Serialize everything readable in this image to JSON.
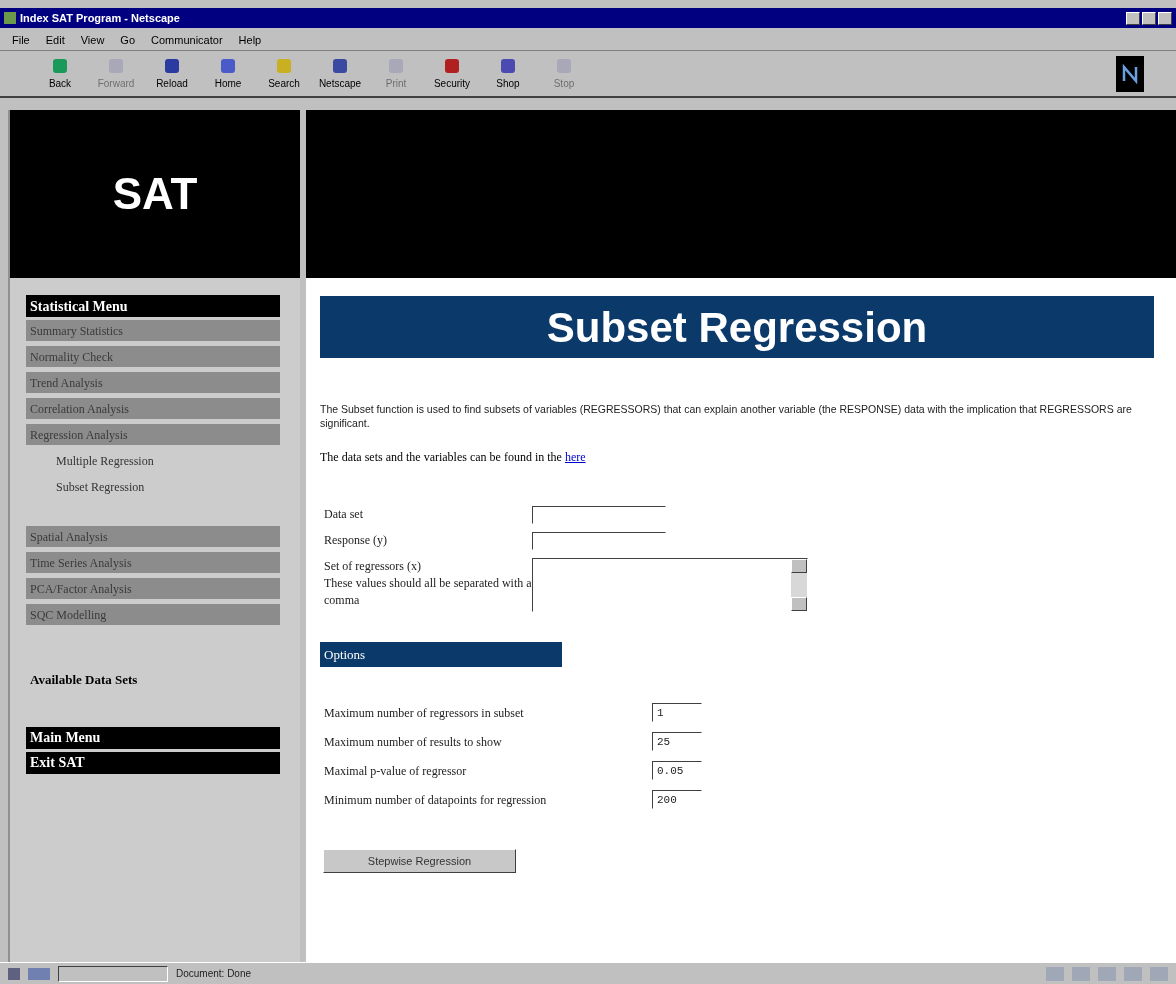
{
  "window": {
    "title": "Index SAT Program - Netscape"
  },
  "menu_bar": [
    "File",
    "Edit",
    "View",
    "Go",
    "Communicator",
    "Help"
  ],
  "toolbar": [
    {
      "label": "Back",
      "disabled": false
    },
    {
      "label": "Forward",
      "disabled": true
    },
    {
      "label": "Reload",
      "disabled": false
    },
    {
      "label": "Home",
      "disabled": false
    },
    {
      "label": "Search",
      "disabled": false
    },
    {
      "label": "Netscape",
      "disabled": false
    },
    {
      "label": "Print",
      "disabled": true
    },
    {
      "label": "Security",
      "disabled": false
    },
    {
      "label": "Shop",
      "disabled": false
    },
    {
      "label": "Stop",
      "disabled": true
    }
  ],
  "banner": {
    "logo": "SAT"
  },
  "sidebar": {
    "heading": "Statistical Menu",
    "items": [
      {
        "label": "Summary Statistics"
      },
      {
        "label": "Normality Check"
      },
      {
        "label": "Trend Analysis"
      },
      {
        "label": "Correlation Analysis"
      },
      {
        "label": "Regression Analysis",
        "children": [
          {
            "label": "Multiple Regression"
          },
          {
            "label": "Subset Regression"
          }
        ]
      },
      {
        "label": "Spatial Analysis"
      },
      {
        "label": "Time Series Analysis"
      },
      {
        "label": "PCA/Factor Analysis"
      },
      {
        "label": "SQC Modelling"
      }
    ],
    "data_sets": "Available Data Sets",
    "footer_items": [
      "Main Menu",
      "Exit SAT"
    ]
  },
  "content": {
    "title": "Subset Regression",
    "description": "The Subset function is used to find subsets of variables (REGRESSORS) that can explain another variable (the RESPONSE) data with the implication that REGRESSORS are significant.",
    "data_note": "The data sets and the variables can be found in the",
    "data_link": "here",
    "fields": [
      {
        "label": "Data set",
        "kind": "text"
      },
      {
        "label": "Response (y)",
        "kind": "text"
      },
      {
        "label": "Set of regressors (x)\nThese values should all be separated with a comma",
        "kind": "textarea"
      }
    ],
    "options_heading": "Options",
    "options": [
      {
        "label": "Maximum number of regressors in subset",
        "value": "1"
      },
      {
        "label": "Maximum number of results to show",
        "value": "25"
      },
      {
        "label": "Maximal p-value of regressor",
        "value": "0.05"
      },
      {
        "label": "Minimum number of datapoints for regression",
        "value": "200"
      }
    ],
    "button": "Stepwise Regression"
  },
  "status_bar": {
    "text": "Document: Done"
  }
}
